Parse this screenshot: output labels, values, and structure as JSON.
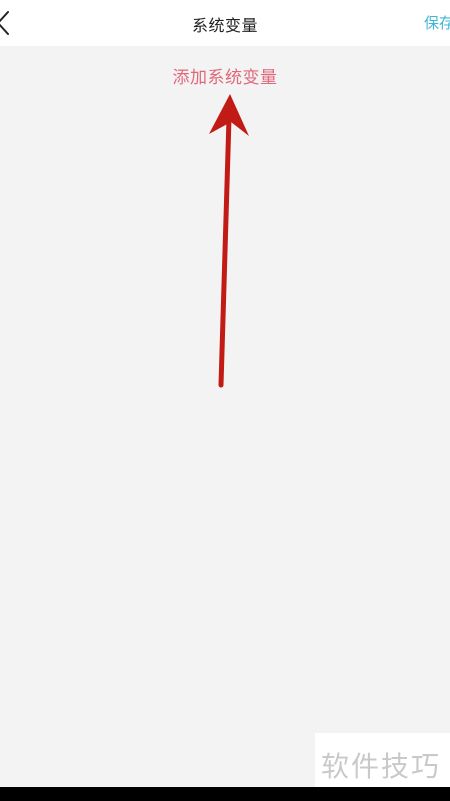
{
  "header": {
    "back_icon": "chevron-left-icon",
    "title": "系统变量",
    "save_label": "保存"
  },
  "main": {
    "add_variable_label": "添加系统变量"
  },
  "annotation": {
    "arrow_icon": "red-arrow-up",
    "color": "#c21a14"
  },
  "watermark": {
    "text": "软件技巧"
  },
  "colors": {
    "accent": "#3fb8d6",
    "link": "#e0687d",
    "background": "#f3f3f3"
  }
}
